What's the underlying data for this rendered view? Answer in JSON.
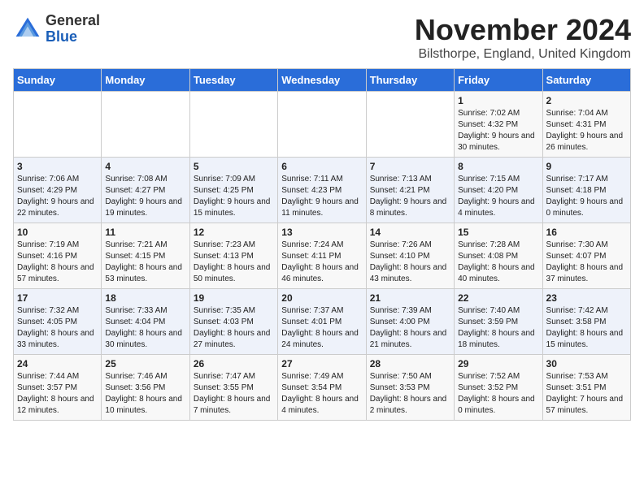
{
  "header": {
    "logo_general": "General",
    "logo_blue": "Blue",
    "month_title": "November 2024",
    "location": "Bilsthorpe, England, United Kingdom"
  },
  "days_of_week": [
    "Sunday",
    "Monday",
    "Tuesday",
    "Wednesday",
    "Thursday",
    "Friday",
    "Saturday"
  ],
  "weeks": [
    [
      {
        "day": "",
        "content": ""
      },
      {
        "day": "",
        "content": ""
      },
      {
        "day": "",
        "content": ""
      },
      {
        "day": "",
        "content": ""
      },
      {
        "day": "",
        "content": ""
      },
      {
        "day": "1",
        "content": "Sunrise: 7:02 AM\nSunset: 4:32 PM\nDaylight: 9 hours and 30 minutes."
      },
      {
        "day": "2",
        "content": "Sunrise: 7:04 AM\nSunset: 4:31 PM\nDaylight: 9 hours and 26 minutes."
      }
    ],
    [
      {
        "day": "3",
        "content": "Sunrise: 7:06 AM\nSunset: 4:29 PM\nDaylight: 9 hours and 22 minutes."
      },
      {
        "day": "4",
        "content": "Sunrise: 7:08 AM\nSunset: 4:27 PM\nDaylight: 9 hours and 19 minutes."
      },
      {
        "day": "5",
        "content": "Sunrise: 7:09 AM\nSunset: 4:25 PM\nDaylight: 9 hours and 15 minutes."
      },
      {
        "day": "6",
        "content": "Sunrise: 7:11 AM\nSunset: 4:23 PM\nDaylight: 9 hours and 11 minutes."
      },
      {
        "day": "7",
        "content": "Sunrise: 7:13 AM\nSunset: 4:21 PM\nDaylight: 9 hours and 8 minutes."
      },
      {
        "day": "8",
        "content": "Sunrise: 7:15 AM\nSunset: 4:20 PM\nDaylight: 9 hours and 4 minutes."
      },
      {
        "day": "9",
        "content": "Sunrise: 7:17 AM\nSunset: 4:18 PM\nDaylight: 9 hours and 0 minutes."
      }
    ],
    [
      {
        "day": "10",
        "content": "Sunrise: 7:19 AM\nSunset: 4:16 PM\nDaylight: 8 hours and 57 minutes."
      },
      {
        "day": "11",
        "content": "Sunrise: 7:21 AM\nSunset: 4:15 PM\nDaylight: 8 hours and 53 minutes."
      },
      {
        "day": "12",
        "content": "Sunrise: 7:23 AM\nSunset: 4:13 PM\nDaylight: 8 hours and 50 minutes."
      },
      {
        "day": "13",
        "content": "Sunrise: 7:24 AM\nSunset: 4:11 PM\nDaylight: 8 hours and 46 minutes."
      },
      {
        "day": "14",
        "content": "Sunrise: 7:26 AM\nSunset: 4:10 PM\nDaylight: 8 hours and 43 minutes."
      },
      {
        "day": "15",
        "content": "Sunrise: 7:28 AM\nSunset: 4:08 PM\nDaylight: 8 hours and 40 minutes."
      },
      {
        "day": "16",
        "content": "Sunrise: 7:30 AM\nSunset: 4:07 PM\nDaylight: 8 hours and 37 minutes."
      }
    ],
    [
      {
        "day": "17",
        "content": "Sunrise: 7:32 AM\nSunset: 4:05 PM\nDaylight: 8 hours and 33 minutes."
      },
      {
        "day": "18",
        "content": "Sunrise: 7:33 AM\nSunset: 4:04 PM\nDaylight: 8 hours and 30 minutes."
      },
      {
        "day": "19",
        "content": "Sunrise: 7:35 AM\nSunset: 4:03 PM\nDaylight: 8 hours and 27 minutes."
      },
      {
        "day": "20",
        "content": "Sunrise: 7:37 AM\nSunset: 4:01 PM\nDaylight: 8 hours and 24 minutes."
      },
      {
        "day": "21",
        "content": "Sunrise: 7:39 AM\nSunset: 4:00 PM\nDaylight: 8 hours and 21 minutes."
      },
      {
        "day": "22",
        "content": "Sunrise: 7:40 AM\nSunset: 3:59 PM\nDaylight: 8 hours and 18 minutes."
      },
      {
        "day": "23",
        "content": "Sunrise: 7:42 AM\nSunset: 3:58 PM\nDaylight: 8 hours and 15 minutes."
      }
    ],
    [
      {
        "day": "24",
        "content": "Sunrise: 7:44 AM\nSunset: 3:57 PM\nDaylight: 8 hours and 12 minutes."
      },
      {
        "day": "25",
        "content": "Sunrise: 7:46 AM\nSunset: 3:56 PM\nDaylight: 8 hours and 10 minutes."
      },
      {
        "day": "26",
        "content": "Sunrise: 7:47 AM\nSunset: 3:55 PM\nDaylight: 8 hours and 7 minutes."
      },
      {
        "day": "27",
        "content": "Sunrise: 7:49 AM\nSunset: 3:54 PM\nDaylight: 8 hours and 4 minutes."
      },
      {
        "day": "28",
        "content": "Sunrise: 7:50 AM\nSunset: 3:53 PM\nDaylight: 8 hours and 2 minutes."
      },
      {
        "day": "29",
        "content": "Sunrise: 7:52 AM\nSunset: 3:52 PM\nDaylight: 8 hours and 0 minutes."
      },
      {
        "day": "30",
        "content": "Sunrise: 7:53 AM\nSunset: 3:51 PM\nDaylight: 7 hours and 57 minutes."
      }
    ]
  ]
}
